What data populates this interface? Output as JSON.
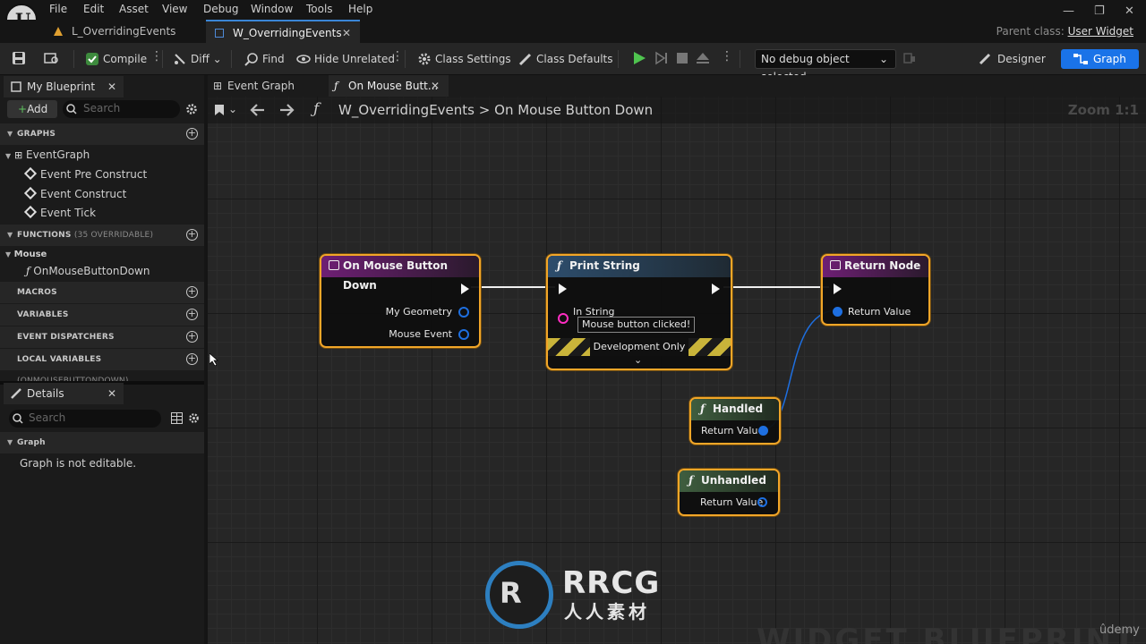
{
  "menu": [
    "File",
    "Edit",
    "Asset",
    "View",
    "Debug",
    "Window",
    "Tools",
    "Help"
  ],
  "tabs": [
    {
      "label": "L_OverridingEvents"
    },
    {
      "label": "W_OverridingEvents"
    }
  ],
  "parent_class": {
    "label": "Parent class:",
    "value": "User Widget"
  },
  "toolbar": {
    "compile": "Compile",
    "diff": "Diff",
    "find": "Find",
    "hide_unrelated": "Hide Unrelated",
    "class_settings": "Class Settings",
    "class_defaults": "Class Defaults",
    "debug_select": "No debug object selected",
    "designer": "Designer",
    "graph": "Graph"
  },
  "my_blueprint": {
    "tab": "My Blueprint",
    "add": "Add",
    "search_placeholder": "Search",
    "sections": {
      "graphs": "GRAPHS",
      "functions": "FUNCTIONS",
      "functions_sub": "(35 OVERRIDABLE)",
      "macros": "MACROS",
      "variables": "VARIABLES",
      "event_dispatchers": "EVENT DISPATCHERS",
      "local_variables": "LOCAL VARIABLES",
      "local_variables_sub": "(ONMOUSEBUTTONDOWN)"
    },
    "graph_items": [
      "EventGraph",
      "Event Pre Construct",
      "Event Construct",
      "Event Tick"
    ],
    "function_category": "Mouse",
    "function_items": [
      "OnMouseButtonDown"
    ]
  },
  "details": {
    "tab": "Details",
    "search_placeholder": "Search",
    "section": "Graph",
    "message": "Graph is not editable."
  },
  "graph_tabs": [
    "Event Graph",
    "On Mouse Butt..."
  ],
  "breadcrumb": {
    "root": "W_OverridingEvents",
    "separator": ">",
    "current": "On Mouse Button Down"
  },
  "zoom": "Zoom 1:1",
  "nodes": {
    "on_mouse_button_down": {
      "title": "On Mouse Button Down",
      "pins": [
        "My Geometry",
        "Mouse Event"
      ],
      "header_color": "#6e1f74"
    },
    "print_string": {
      "title": "Print String",
      "pin": "In String",
      "value": "Mouse button clicked!",
      "footer": "Development Only",
      "header_color": "#2d4d6c"
    },
    "return_node": {
      "title": "Return Node",
      "pin": "Return Value",
      "header_color": "#6e1f74"
    },
    "handled": {
      "title": "Handled",
      "pin": "Return Value",
      "header_color": "#3f5e3f"
    },
    "unhandled": {
      "title": "Unhandled",
      "pin": "Return Value",
      "header_color": "#3f5e3f"
    }
  },
  "watermark": {
    "text": "WIDGET BLUEPRINT",
    "logo_text": "RRCG",
    "logo_sub": "人人素材",
    "udemy": "ûdemy"
  }
}
